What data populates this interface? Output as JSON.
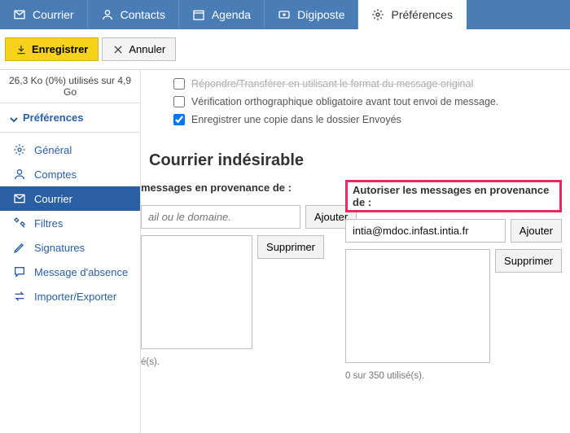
{
  "tabs": {
    "mail": "Courrier",
    "contacts": "Contacts",
    "agenda": "Agenda",
    "digiposte": "Digiposte",
    "prefs": "Préférences"
  },
  "toolbar": {
    "save": "Enregistrer",
    "cancel": "Annuler"
  },
  "storage": {
    "text": "26,3 Ko (0%) utilisés sur 4,9 Go"
  },
  "sidebar": {
    "group": "Préférences",
    "items": {
      "general": "Général",
      "accounts": "Comptes",
      "mail": "Courrier",
      "filters": "Filtres",
      "signatures": "Signatures",
      "away": "Message d'absence",
      "importexport": "Importer/Exporter"
    }
  },
  "checks": {
    "reply_format": "Répondre/Transférer en utilisant le format du message original",
    "spellcheck": "Vérification orthographique obligatoire avant tout envoi de message.",
    "save_sent": "Enregistrer une copie dans le dossier Envoyés"
  },
  "spam": {
    "title": "Courrier indésirable",
    "block_label": "messages en provenance de :",
    "allow_label": "Autoriser les messages en provenance de :",
    "placeholder": "ail ou le domaine.",
    "allow_value": "intia@mdoc.infast.intia.fr",
    "add_btn": "Ajouter",
    "del_btn": "Supprimer",
    "counter_left": "é(s).",
    "counter_right": "0 sur 350 utilisé(s)."
  }
}
